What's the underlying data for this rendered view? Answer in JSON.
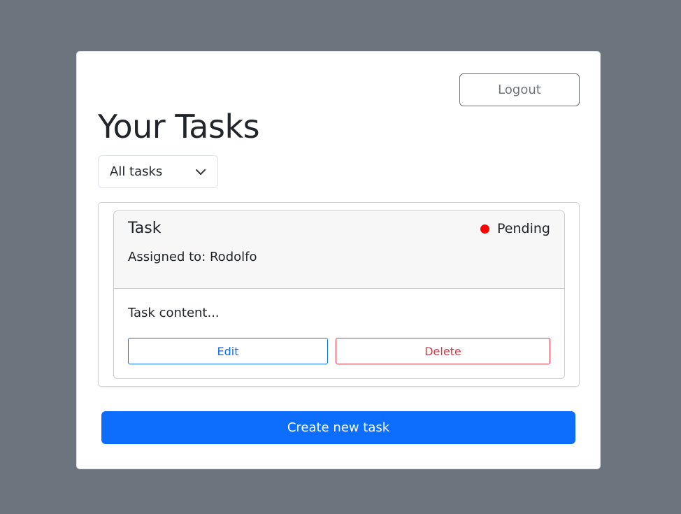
{
  "header": {
    "logout_label": "Logout",
    "title": "Your Tasks"
  },
  "filter": {
    "selected": "All tasks"
  },
  "tasks": [
    {
      "title": "Task",
      "status": "Pending",
      "status_color": "#ff0000",
      "assigned": "Assigned to: Rodolfo",
      "content": "Task content...",
      "edit_label": "Edit",
      "delete_label": "Delete"
    }
  ],
  "footer": {
    "create_label": "Create new task"
  },
  "colors": {
    "primary": "#0d6efd",
    "danger": "#dc3545",
    "background": "#6c757d"
  }
}
